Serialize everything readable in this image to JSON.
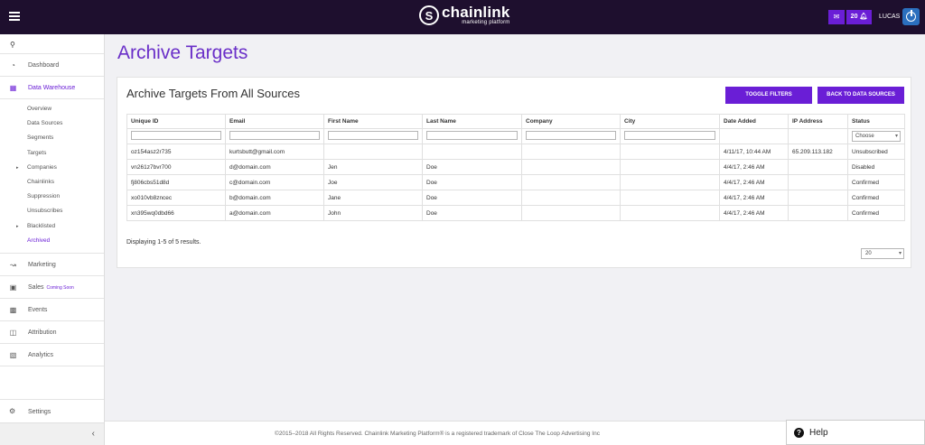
{
  "header": {
    "logo_mark": "S",
    "logo_name": "chainlink",
    "logo_sub": "marketing platform",
    "notification_count": "20",
    "user": "LUCAS"
  },
  "sidebar": {
    "items": {
      "dashboard": "Dashboard",
      "data_warehouse": "Data Warehouse",
      "marketing": "Marketing",
      "sales": "Sales",
      "sales_badge": "Coming Soon",
      "events": "Events",
      "attribution": "Attribution",
      "analytics": "Analytics",
      "settings": "Settings"
    },
    "sub_items": [
      "Overview",
      "Data Sources",
      "Segments",
      "Targets",
      "Companies",
      "Chainlinks",
      "Suppression",
      "Unsubscribes",
      "Blacklisted",
      "Archived"
    ]
  },
  "page": {
    "title": "Archive Targets",
    "panel_title": "Archive Targets From All Sources",
    "toggle_filters": "TOGGLE FILTERS",
    "back_to_sources": "BACK TO DATA SOURCES",
    "status_filter": "Choose",
    "summary": "Displaying 1-5 of 5 results.",
    "per_page": "20"
  },
  "table": {
    "columns": [
      "Unique ID",
      "Email",
      "First Name",
      "Last Name",
      "Company",
      "City",
      "Date Added",
      "IP Address",
      "Status"
    ],
    "rows": [
      [
        "oz154asz2r735",
        "kurtsbutt@gmail.com",
        "",
        "",
        "",
        "",
        "4/11/17, 10:44 AM",
        "65.209.113.182",
        "Unsubscribed"
      ],
      [
        "vn261z7bvr700",
        "d@domain.com",
        "Jen",
        "Doe",
        "",
        "",
        "4/4/17, 2:46 AM",
        "",
        "Disabled"
      ],
      [
        "fj806cbs51d8d",
        "c@domain.com",
        "Joe",
        "Doe",
        "",
        "",
        "4/4/17, 2:46 AM",
        "",
        "Confirmed"
      ],
      [
        "xo010vb8zncec",
        "b@domain.com",
        "Jane",
        "Doe",
        "",
        "",
        "4/4/17, 2:46 AM",
        "",
        "Confirmed"
      ],
      [
        "xn395wq0dbd66",
        "a@domain.com",
        "John",
        "Doe",
        "",
        "",
        "4/4/17, 2:46 AM",
        "",
        "Confirmed"
      ]
    ]
  },
  "footer": {
    "text": "©2015–2018 All Rights Reserved. Chainlink Marketing Platform® is a registered trademark of Close The Loop Advertising Inc",
    "help": "Help"
  },
  "colors": {
    "accent": "#6a1ed6",
    "topbar": "#1e0f2e",
    "title": "#6a2fc8"
  }
}
